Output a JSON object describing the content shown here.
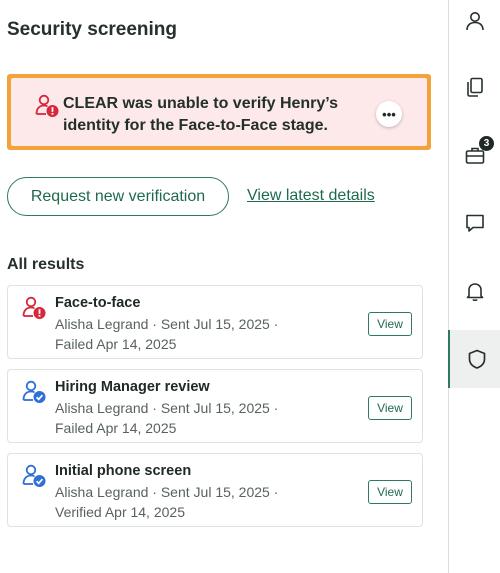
{
  "panel": {
    "title": "Security screening",
    "alert": {
      "message": "CLEAR was unable to verify Henry’s identity for the Face-to-Face stage.",
      "more_label": "•••"
    },
    "actions": {
      "request_label": "Request new verification",
      "view_latest_label": "View latest details"
    },
    "results_heading": "All results",
    "results": [
      {
        "title": "Face-to-face",
        "line1": "Alisha Legrand · Sent Jul 15, 2025 ·",
        "line2": "Failed Apr 14, 2025",
        "status": "failed",
        "view_label": "View"
      },
      {
        "title": "Hiring Manager review",
        "line1": "Alisha Legrand · Sent Jul 15, 2025 ·",
        "line2": "Failed Apr 14, 2025",
        "status": "verified",
        "view_label": "View"
      },
      {
        "title": "Initial phone screen",
        "line1": "Alisha Legrand · Sent Jul 15, 2025 ·",
        "line2": "Verified Apr 14, 2025",
        "status": "verified",
        "view_label": "View"
      }
    ]
  },
  "rail": {
    "items": [
      {
        "icon": "person-icon"
      },
      {
        "icon": "documents-icon"
      },
      {
        "icon": "briefcase-icon",
        "badge": "3"
      },
      {
        "icon": "chat-icon"
      },
      {
        "icon": "bell-icon"
      },
      {
        "icon": "shield-icon",
        "active": true
      }
    ]
  },
  "colors": {
    "accent": "#2e7a5b",
    "alert_border": "#f2a33a",
    "alert_bg": "#fde9ea",
    "error": "#d6283a",
    "verified": "#2f6fd6"
  }
}
